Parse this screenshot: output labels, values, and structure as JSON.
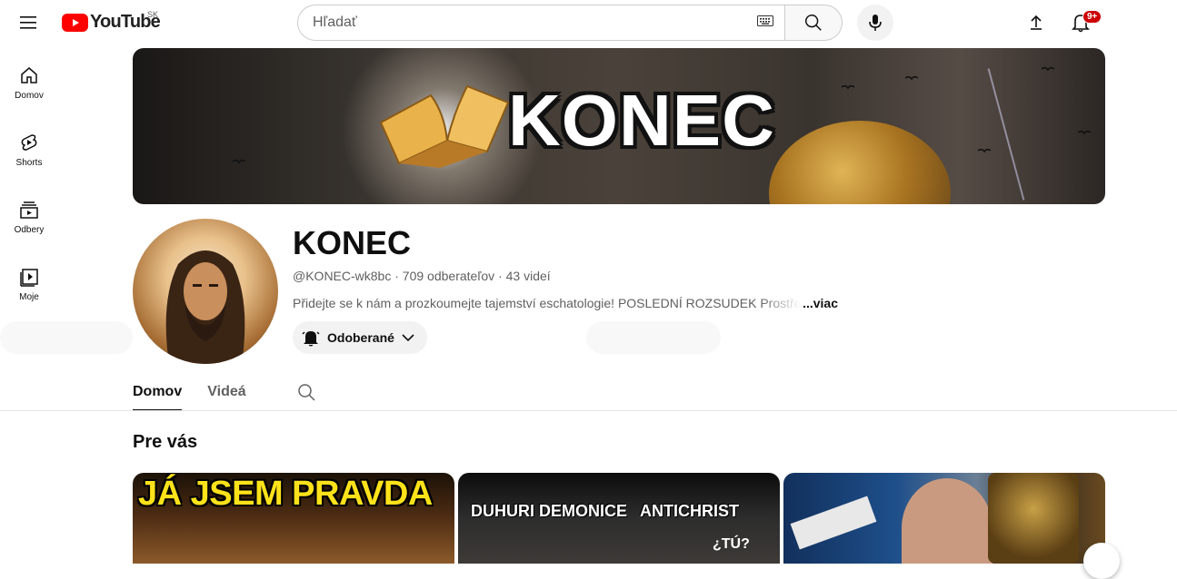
{
  "header": {
    "logo_text": "YouTube",
    "country_code": "SK",
    "search_placeholder": "Hľadať",
    "notifications_badge": "9+"
  },
  "sidebar": {
    "items": [
      {
        "label": "Domov",
        "icon": "home-icon"
      },
      {
        "label": "Shorts",
        "icon": "shorts-icon"
      },
      {
        "label": "Odbery",
        "icon": "subscriptions-icon"
      },
      {
        "label": "Moje",
        "icon": "library-icon"
      }
    ]
  },
  "banner": {
    "title": "KONEC"
  },
  "channel": {
    "name": "KONEC",
    "handle": "@KONEC-wk8bc",
    "subscribers": "709 odberateľov",
    "videos": "43 videí",
    "description": "Přidejte se k nám a prozkoumejte tajemství eschatologie! POSLEDNÍ ROZSUDEK Prostředn",
    "more_label": "...viac",
    "subscribe_label": "Odoberané"
  },
  "tabs": [
    {
      "label": "Domov",
      "active": true
    },
    {
      "label": "Videá",
      "active": false
    }
  ],
  "section": {
    "title": "Pre vás"
  },
  "videos": [
    {
      "thumb_text": "JÁ JSEM PRAVDA"
    },
    {
      "thumb_text_left": "DUHURI DEMONICE",
      "thumb_text_right": "ANTICHRIST",
      "thumb_text_bottom": "¿TÚ?"
    },
    {
      "thumb_text": ""
    }
  ],
  "colors": {
    "brand_red": "#ff0000",
    "badge_red": "#cc0000",
    "thumb_yellow": "#ffe21a"
  }
}
